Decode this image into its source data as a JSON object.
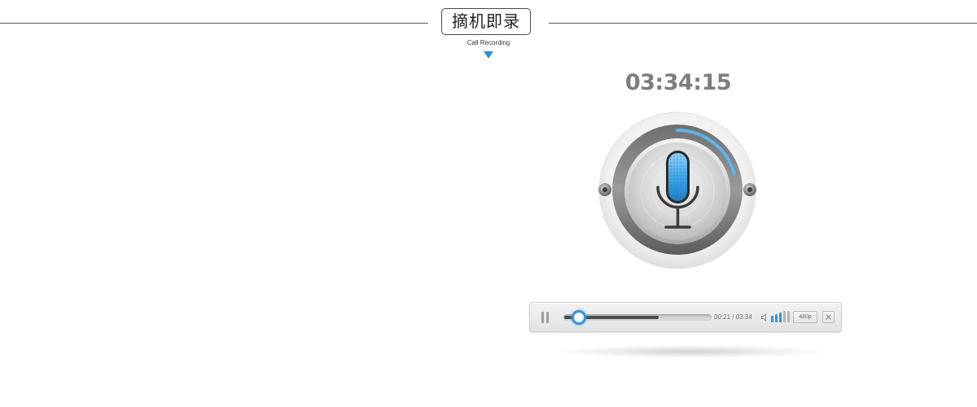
{
  "header": {
    "title": "摘机即录",
    "subtitle": "Call Recording"
  },
  "recorder": {
    "timer": "03:34:15",
    "mic_icon": "microphone-icon",
    "accent_color": "#2f95dd"
  },
  "player": {
    "pause_icon": "pause-icon",
    "progress_fraction": 0.1,
    "buffered_fraction": 0.64,
    "time_display": "00:21 / 03:34",
    "volume_icon": "speaker-icon",
    "volume_level": 3,
    "volume_max": 5,
    "quality": "480p",
    "close_icon": "close-icon"
  }
}
